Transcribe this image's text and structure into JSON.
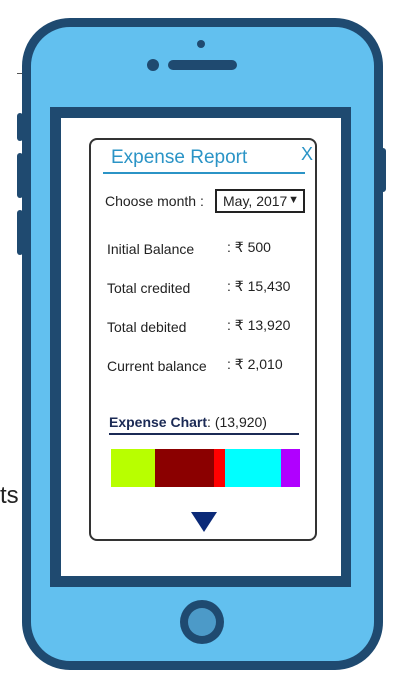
{
  "background_fragment": "ts",
  "dialog": {
    "title": "Expense Report",
    "close_label": "X",
    "month_label": "Choose month :",
    "month_value": "May, 2017",
    "month_arrow": "▼",
    "rows": [
      {
        "label": "Initial Balance",
        "value": ": ₹ 500"
      },
      {
        "label": "Total credited",
        "value": ": ₹ 15,430"
      },
      {
        "label": "Total debited",
        "value": ": ₹ 13,920"
      },
      {
        "label": "Current balance",
        "value": ": ₹ 2,010"
      }
    ],
    "chart_title": "Expense Chart",
    "chart_total": ": (13,920)"
  },
  "chart_data": {
    "type": "bar",
    "orientation": "stacked-horizontal",
    "total": 13920,
    "segments": [
      {
        "color": "#b8ff00",
        "fraction": 0.24
      },
      {
        "color": "#8b0000",
        "fraction": 0.32
      },
      {
        "color": "#ff0000",
        "fraction": 0.06
      },
      {
        "color": "#00ffff",
        "fraction": 0.3
      },
      {
        "color": "#b000ff",
        "fraction": 0.1
      }
    ]
  },
  "colors": {
    "phone_body": "#62c0ef",
    "phone_border": "#1f4a70",
    "accent": "#2b94c6",
    "chart_heading": "#1b2a55",
    "triangle": "#0b2a78"
  },
  "icons": {
    "close": "close-icon",
    "dropdown": "chevron-down-icon",
    "more": "triangle-down-icon"
  }
}
